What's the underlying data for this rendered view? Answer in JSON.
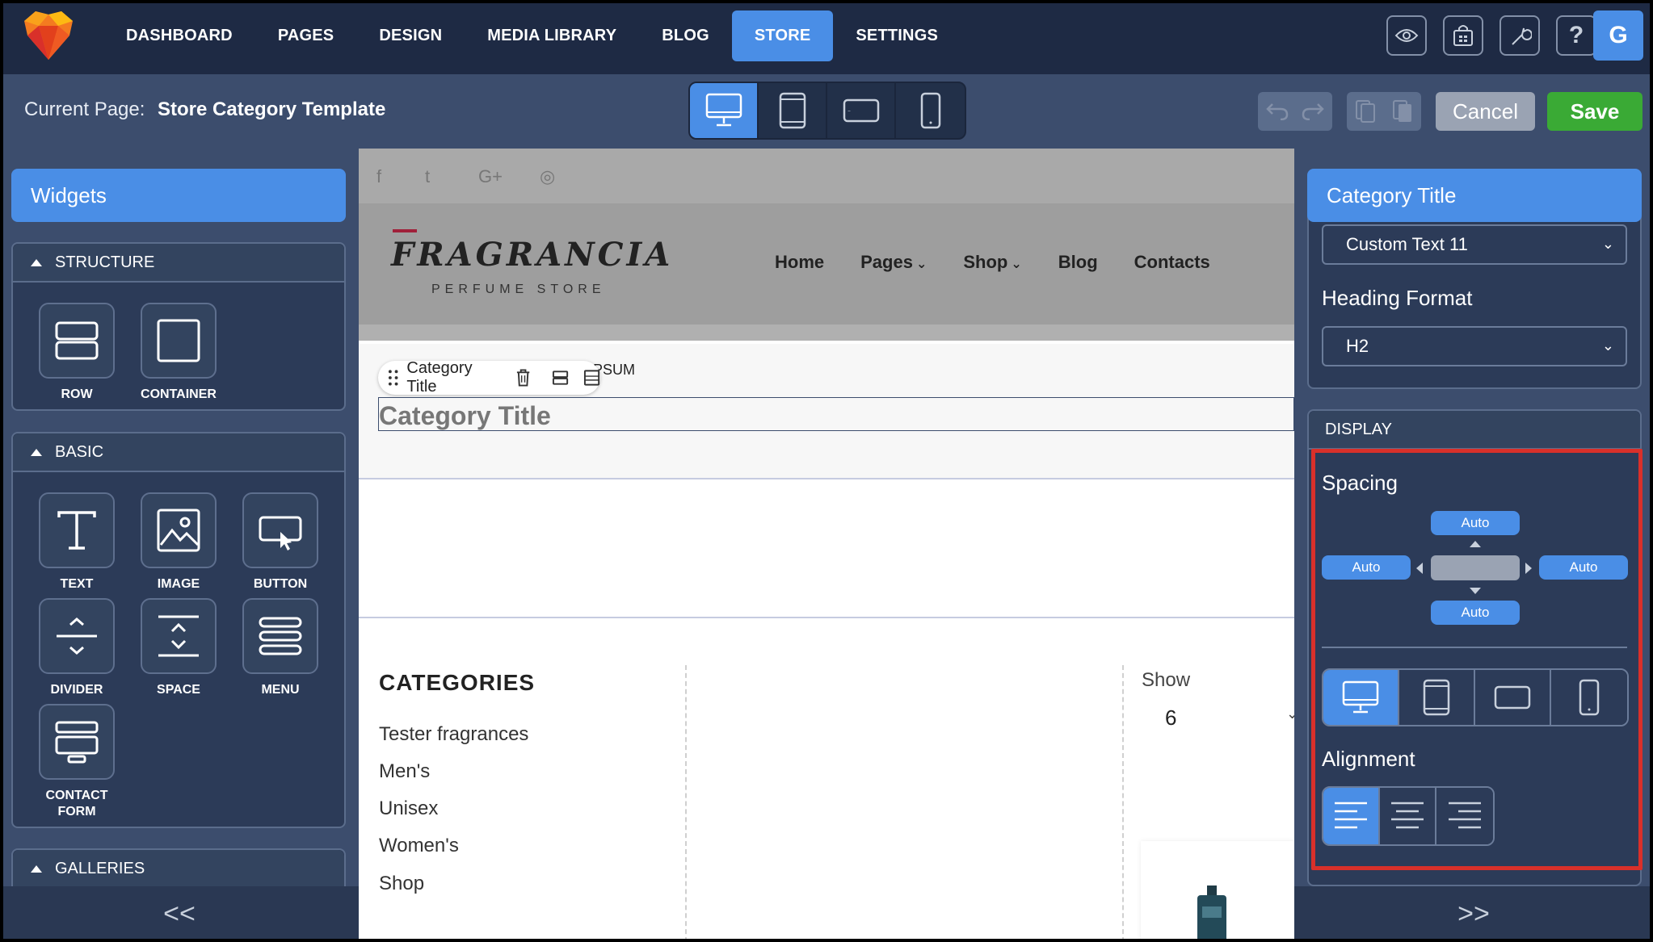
{
  "nav": {
    "items": [
      "DASHBOARD",
      "PAGES",
      "DESIGN",
      "MEDIA LIBRARY",
      "BLOG",
      "STORE",
      "SETTINGS"
    ],
    "active": "STORE",
    "user_initial": "G"
  },
  "subbar": {
    "current_label": "Current Page:",
    "current_value": "Store Category Template",
    "cancel_label": "Cancel",
    "save_label": "Save"
  },
  "left": {
    "title": "Widgets",
    "structure": {
      "heading": "STRUCTURE",
      "widgets": [
        "ROW",
        "CONTAINER"
      ]
    },
    "basic": {
      "heading": "BASIC",
      "widgets": [
        "TEXT",
        "IMAGE",
        "BUTTON",
        "DIVIDER",
        "SPACE",
        "MENU",
        "CONTACT FORM"
      ]
    },
    "galleries": {
      "heading": "GALLERIES"
    },
    "collapse": "<<"
  },
  "canvas": {
    "social": [
      "f",
      "t",
      "G+",
      "◎"
    ],
    "logo_main": "FRAGRANCIA",
    "logo_sub": "PERFUME STORE",
    "site_nav": [
      "Home",
      "Pages",
      "Shop",
      "Blog",
      "Contacts"
    ],
    "chip_label": "Category Title",
    "behind_text": "PSUM",
    "title": "Category Title",
    "categories_heading": "CATEGORIES",
    "categories": [
      "Tester fragrances",
      "Men's",
      "Unisex",
      "Women's",
      "Shop"
    ],
    "show_label": "Show",
    "show_value": "6"
  },
  "right": {
    "title": "Category Title",
    "prev_select": "Custom Text 11",
    "heading_format_label": "Heading Format",
    "heading_format_value": "H2",
    "display_heading": "DISPLAY",
    "spacing_label": "Spacing",
    "spacing": {
      "top": "Auto",
      "left": "Auto",
      "right": "Auto",
      "bottom": "Auto"
    },
    "alignment_label": "Alignment",
    "expand": ">>"
  },
  "colors": {
    "accent": "#4a8ee6",
    "save": "#3aaa35",
    "highlight": "#d9302a",
    "nav_bg": "#1e2a44",
    "panel_bg": "#3c4d6d"
  }
}
